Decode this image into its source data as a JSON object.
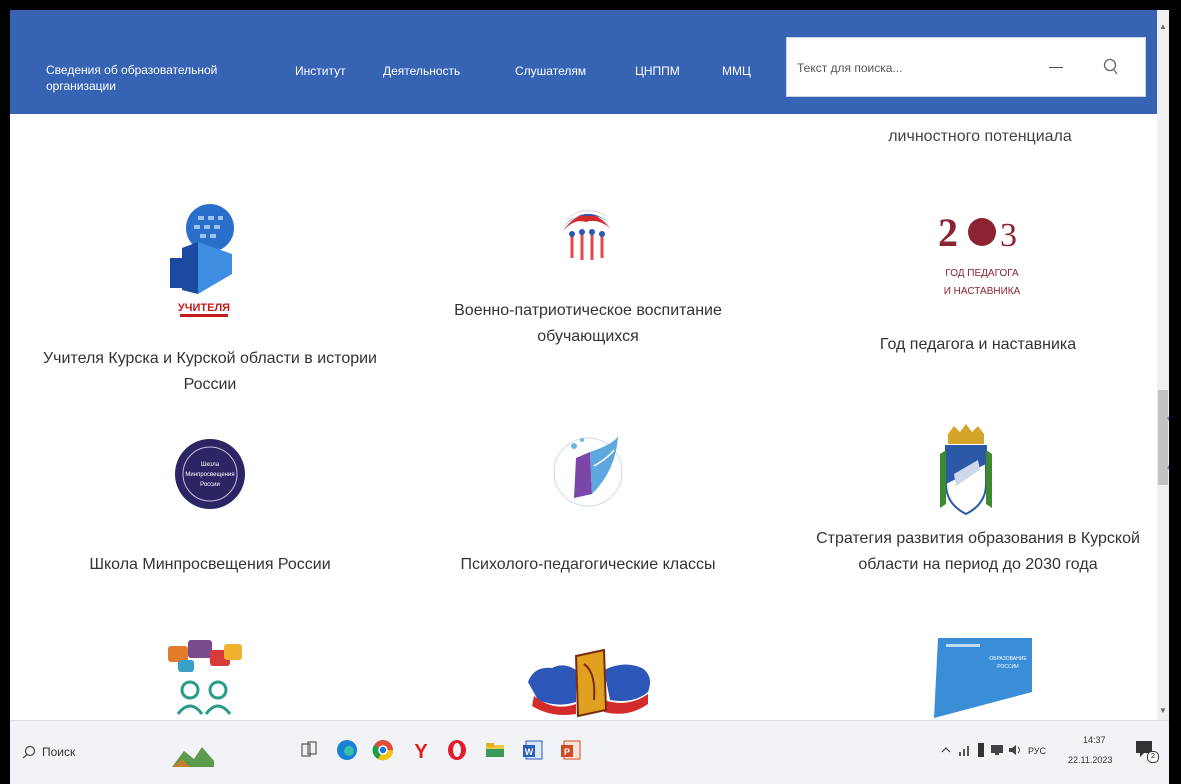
{
  "header": {
    "nav": [
      {
        "label": "Сведения об образовательной организации"
      },
      {
        "label": "Институт"
      },
      {
        "label": "Деятельность"
      },
      {
        "label": "Слушателям"
      },
      {
        "label": "ЦНППМ"
      },
      {
        "label": "ММЦ"
      }
    ],
    "search": {
      "placeholder": "Текст для поиска...",
      "dash": "—"
    }
  },
  "content": {
    "top_partial_caption": "личностного потенциала",
    "cards": [
      {
        "caption": "Учителя Курска и Курской области в истории России",
        "logo_text": "УЧИТЕЛЯ",
        "icon": "teachers-logo-icon"
      },
      {
        "caption": "Военно-патриотическое воспитание обучающихся",
        "icon": "patriotic-education-logo-icon"
      },
      {
        "caption": "Год педагога и наставника",
        "logo_text": "ГОД ПЕДАГОГА И НАСТАВНИКА",
        "icon": "year-of-teacher-logo-icon"
      },
      {
        "caption": "Школа Минпросвещения России",
        "icon": "school-minpros-logo-icon"
      },
      {
        "caption": "Психолого-педагогические классы",
        "icon": "psych-classes-logo-icon"
      },
      {
        "caption": "Стратегия развития образования в Курской области на период до 2030 года",
        "icon": "kursk-coat-of-arms-icon"
      },
      {
        "icon": "dialog-people-logo-icon"
      },
      {
        "icon": "russia-map-book-logo-icon"
      },
      {
        "icon": "blue-flag-logo-icon"
      }
    ]
  },
  "taskbar": {
    "search_label": "Поиск",
    "language": "РУС",
    "time": "14:37",
    "date": "22.11.2023",
    "notifications": "2"
  },
  "colors": {
    "header_bg": "#3663b3",
    "accent_red": "#8b2332",
    "taskbar_bg": "#f1f3f7"
  }
}
